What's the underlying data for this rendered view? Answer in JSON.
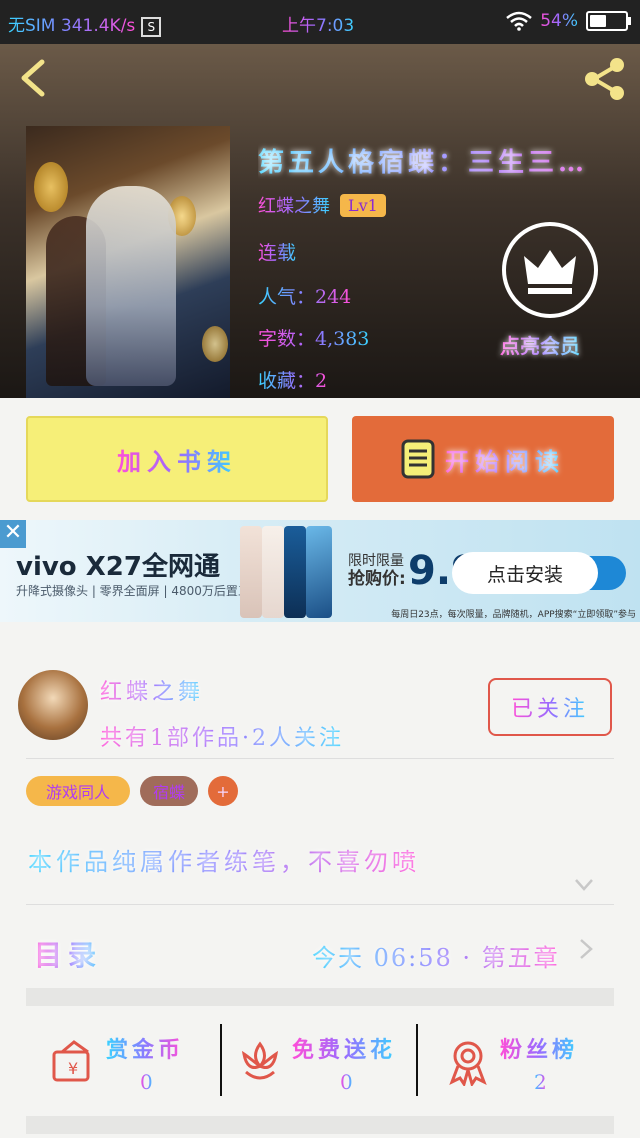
{
  "status_bar": {
    "carrier": "无SIM 341.4K/s",
    "s_icon": "S",
    "time": "上午7:03",
    "battery_text": "54%",
    "battery_level": 0.54,
    "icons": [
      "wifi-icon",
      "battery-icon"
    ]
  },
  "book": {
    "title": "第五人格宿蝶：三生三…",
    "author": "红蝶之舞",
    "level": "Lv1",
    "status": "连载",
    "popularity": "人气：244",
    "word_count": "字数：4,383",
    "favorites": "收藏：2",
    "vip_label": "点亮会员"
  },
  "actions": {
    "add_shelf": "加入书架",
    "start_reading": "开始阅读"
  },
  "ad": {
    "close": "✕",
    "brand": "vivo X27全网通",
    "subtitle": "升降式摄像头 | 零界全面屏 | 4800万后置三摄",
    "limit_line1": "限时限量",
    "limit_line2": "抢购价:",
    "price": "9.9",
    "install": "点击安装",
    "fine_print": "每周日23点，每次限量，品牌随机，APP搜索“立即领取”参与"
  },
  "author_card": {
    "name": "红蝶之舞",
    "stats": "共有1部作品·2人关注",
    "follow_label": "已关注",
    "tags": [
      "游戏同人",
      "宿蝶",
      "+"
    ],
    "description": "本作品纯属作者练笔，不喜勿喷",
    "toc_label": "目录",
    "latest": "今天 06:58 · 第五章",
    "stats_row": [
      {
        "label": "赏金币",
        "value": "0",
        "icon": "reward-coin-icon"
      },
      {
        "label": "免费送花",
        "value": "0",
        "icon": "flower-icon"
      },
      {
        "label": "粉丝榜",
        "value": "2",
        "icon": "medal-icon"
      }
    ]
  },
  "colors": {
    "add_shelf_bg": "#f6ef78",
    "read_bg": "#e36b3a",
    "follow_border": "#e0574a",
    "tag1_bg": "#f5b74a",
    "tag2_bg": "#a06c5a",
    "tag3_bg": "#e36b3a"
  }
}
